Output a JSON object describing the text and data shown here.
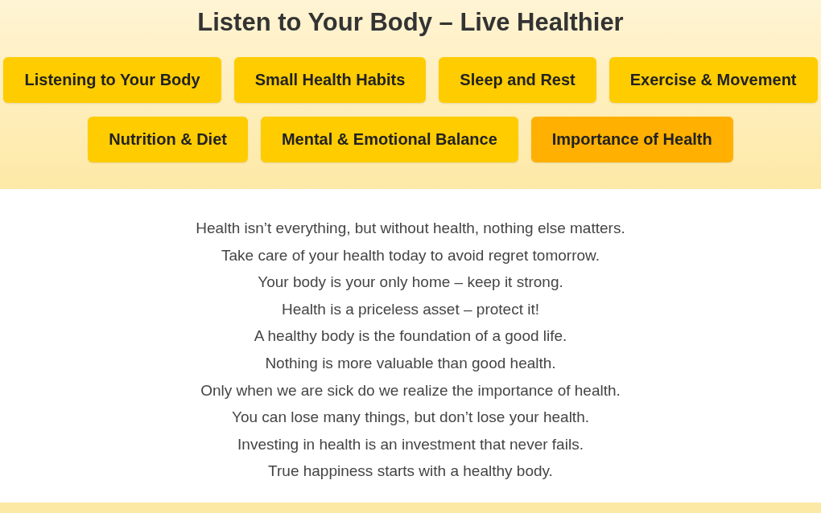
{
  "title": "Listen to Your Body – Live Healthier",
  "tabs": [
    {
      "label": "Listening to Your Body",
      "selected": false
    },
    {
      "label": "Small Health Habits",
      "selected": false
    },
    {
      "label": "Sleep and Rest",
      "selected": false
    },
    {
      "label": "Exercise & Movement",
      "selected": false
    },
    {
      "label": "Nutrition & Diet",
      "selected": false
    },
    {
      "label": "Mental & Emotional Balance",
      "selected": false
    },
    {
      "label": "Importance of Health",
      "selected": true
    }
  ],
  "quotes": [
    "Health isn’t everything, but without health, nothing else matters.",
    "Take care of your health today to avoid regret tomorrow.",
    "Your body is your only home – keep it strong.",
    "Health is a priceless asset – protect it!",
    "A healthy body is the foundation of a good life.",
    "Nothing is more valuable than good health.",
    "Only when we are sick do we realize the importance of health.",
    "You can lose many things, but don’t lose your health.",
    "Investing in health is an investment that never fails.",
    "True happiness starts with a healthy body."
  ]
}
